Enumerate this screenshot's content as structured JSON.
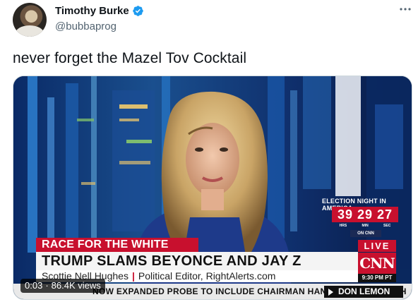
{
  "author": {
    "display_name": "Timothy Burke",
    "handle": "@bubbaprog",
    "verified": true
  },
  "tweet": {
    "text": "never forget the Mazel Tov Cocktail"
  },
  "video": {
    "elapsed": "0:03",
    "views": "86.4K views",
    "separator": "·",
    "broadcast": {
      "race_label": "RACE FOR THE WHITE HOUSE",
      "headline": "TRUMP SLAMS BEYONCE AND JAY Z",
      "guest_name": "Scottie Nell Hughes",
      "guest_title": "Political Editor, RightAlerts.com",
      "ticker_text": "NOW EXPANDED PROBE TO INCLUDE CHAIRMAN HANS DIETER POTSCH",
      "show_name": "DON LEMON",
      "live_label": "LIVE",
      "network": "CNN",
      "clock": "9:30 PM PT",
      "countdown_title": "ELECTION NIGHT IN AMERICA",
      "countdown_digits": "39 29 27",
      "countdown_units": [
        "HRS",
        "MIN",
        "SEC"
      ],
      "countdown_sub": "ON CNN"
    }
  },
  "colors": {
    "accent": "#1d9bf0",
    "cnn_red": "#c8102e",
    "text_primary": "#0f1419",
    "text_secondary": "#536471"
  },
  "icons": {
    "verified": "verified-badge-icon",
    "more": "more-dots-icon"
  }
}
